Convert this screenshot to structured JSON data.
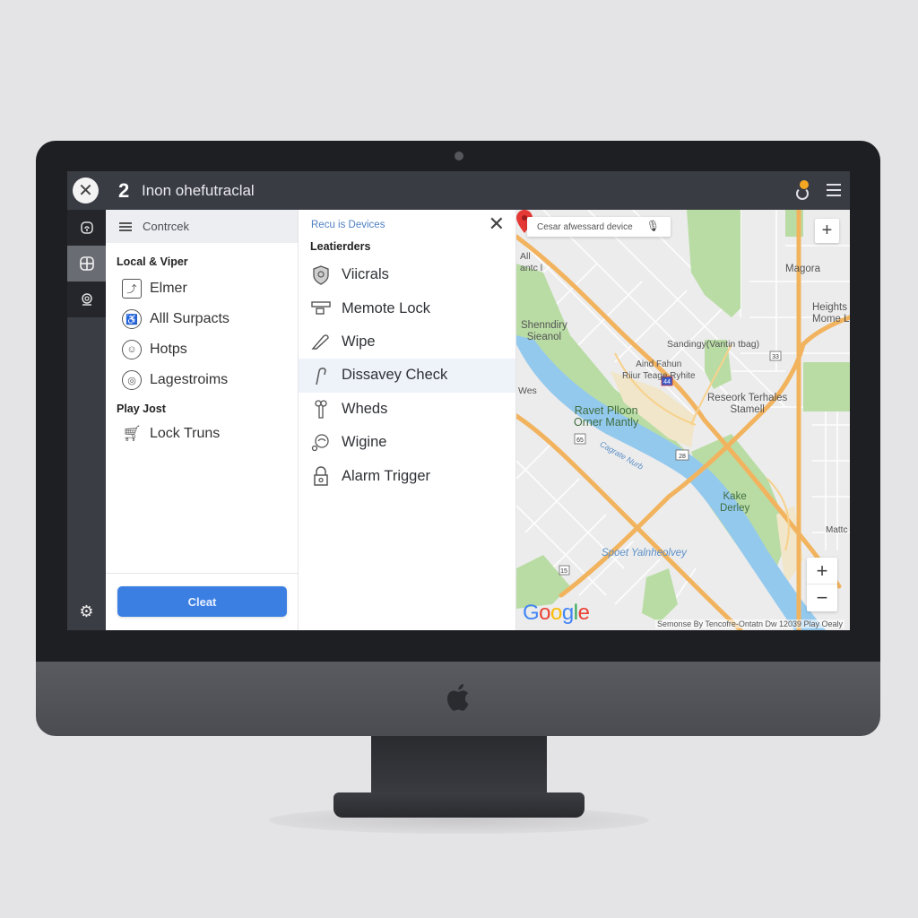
{
  "app": {
    "tab_number": "2",
    "title": "Inon ohefutraclal",
    "close_icon": "close-icon",
    "top_icons": [
      "refresh-icon",
      "menu-icon"
    ]
  },
  "rail": {
    "items": [
      {
        "icon": "lock-device-icon",
        "active": false
      },
      {
        "icon": "window-icon",
        "active": true
      },
      {
        "icon": "webcam-icon",
        "active": false
      }
    ],
    "bottom_icon": "settings-gear-icon"
  },
  "panel1": {
    "header": "Contrcek",
    "sections": [
      {
        "title": "Local & Viper",
        "items": [
          {
            "label": "Elmer",
            "icon": "chart-box-icon"
          },
          {
            "label": "Alll Surpacts",
            "icon": "accessibility-icon"
          },
          {
            "label": "Hotps",
            "icon": "user-badge-icon"
          },
          {
            "label": "Lagestroims",
            "icon": "target-icon"
          }
        ]
      },
      {
        "title": "Play Jost",
        "items": [
          {
            "label": "Lock Truns",
            "icon": "cart-icon"
          }
        ]
      }
    ],
    "button_label": "Cleat"
  },
  "panel2": {
    "breadcrumb": "Recu is Devices",
    "title": "Leatierders",
    "items": [
      {
        "label": "Viicrals",
        "icon": "shield-icon",
        "highlighted": false
      },
      {
        "label": "Memote Lock",
        "icon": "device-lock-icon",
        "highlighted": false
      },
      {
        "label": "Wipe",
        "icon": "eraser-icon",
        "highlighted": false
      },
      {
        "label": "Dissavey Check",
        "icon": "hook-icon",
        "highlighted": true
      },
      {
        "label": "Wheds",
        "icon": "key-icon",
        "highlighted": false
      },
      {
        "label": "Wigine",
        "icon": "engine-icon",
        "highlighted": false
      },
      {
        "label": "Alarm Trigger",
        "icon": "padlock-icon",
        "highlighted": false
      }
    ]
  },
  "map": {
    "search_placeholder": "Cesar afwessard device",
    "labels": {
      "top_left": "All\nantc l",
      "magora": "Magora",
      "heights": "Heights\nMome L",
      "shenndiry": "Shenndiry\nSieanol",
      "sandingy": "Sandingy(Vantin tbag)",
      "aind_fahun": "Aind Fahun\nRiiur Teage Ryhite",
      "wes": "Wes",
      "reseork": "Reseork Terhales\nStamell",
      "ravet": "Ravet Plloon\nOrner Mantly",
      "cagrate": "Cagrate Nurb",
      "kake": "Kake\nDerley",
      "matt": "Mattc",
      "spoet": "Spoet Yalnheolvey"
    },
    "shields": [
      "33",
      "44",
      "65",
      "28",
      "15"
    ],
    "brand": "Google",
    "attribution": "Semonse By Tencofre-Ontatn Dw 12039 Play  Oealy",
    "colors": {
      "land": "#ececec",
      "park": "#b7dca3",
      "water": "#8fc7ee",
      "highway": "#f2b35e",
      "pin": "#e53935"
    }
  }
}
